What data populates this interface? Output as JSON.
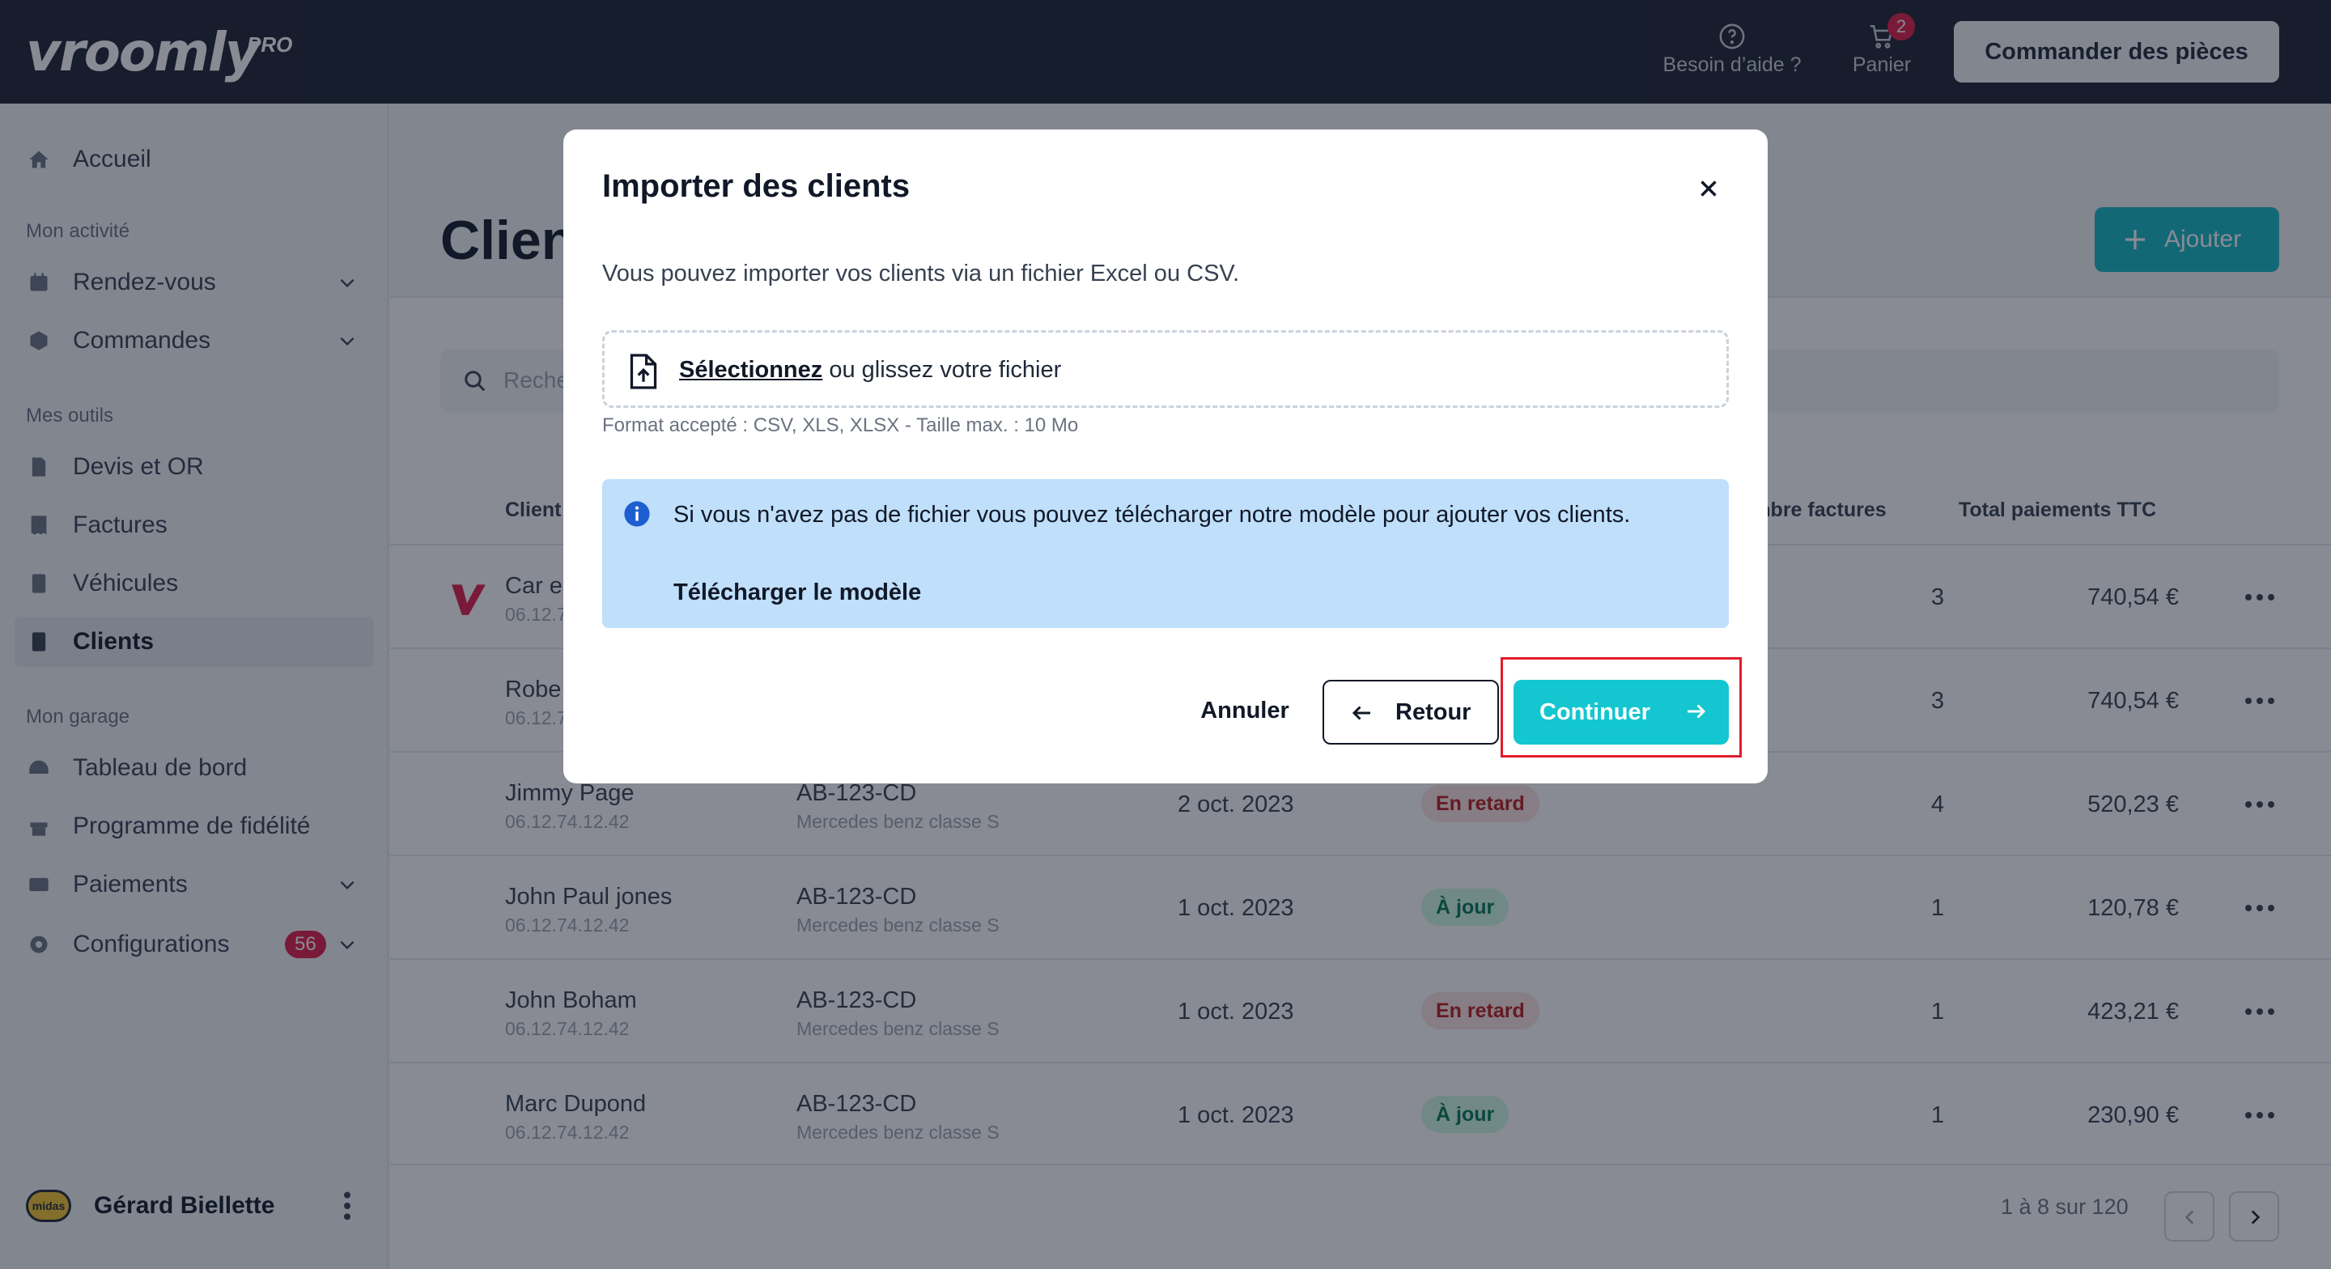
{
  "app": {
    "logo": "vroomly",
    "logo_badge": "PRO"
  },
  "topbar": {
    "help_label": "Besoin d’aide ?",
    "cart_label": "Panier",
    "cart_count": "2",
    "order_button": "Commander des pièces"
  },
  "sidebar": {
    "home": "Accueil",
    "section_activity": "Mon activité",
    "appointments": "Rendez-vous",
    "orders": "Commandes",
    "section_tools": "Mes outils",
    "quotes": "Devis et OR",
    "invoices": "Factures",
    "vehicles": "Véhicules",
    "clients": "Clients",
    "section_garage": "Mon garage",
    "dashboard": "Tableau de bord",
    "loyalty": "Programme de fidélité",
    "payments": "Paiements",
    "settings": "Configurations",
    "settings_badge": "56",
    "user_name": "Gérard Biellette",
    "avatar_text": "midas"
  },
  "page": {
    "title": "Clients",
    "add_button": "Ajouter",
    "search_placeholder": "Rechercher",
    "columns": {
      "client": "Client",
      "invoice_count": "Nombre factures",
      "total": "Total paiements TTC"
    },
    "rows": [
      {
        "name": "Car e",
        "phone": "06.12.74.12.42",
        "count": "3",
        "total": "740,54 €"
      },
      {
        "name": "Robe",
        "phone": "06.12.74.12.42",
        "count": "3",
        "total": "740,54 €"
      },
      {
        "name": "Jimmy Page",
        "phone": "06.12.74.12.42",
        "plate": "AB-123-CD",
        "model": "Mercedes benz classe S",
        "date": "2 oct. 2023",
        "status": "En retard",
        "count": "4",
        "total": "520,23 €"
      },
      {
        "name": "John Paul jones",
        "phone": "06.12.74.12.42",
        "plate": "AB-123-CD",
        "model": "Mercedes benz classe S",
        "date": "1 oct. 2023",
        "status": "À jour",
        "count": "1",
        "total": "120,78 €"
      },
      {
        "name": "John Boham",
        "phone": "06.12.74.12.42",
        "plate": "AB-123-CD",
        "model": "Mercedes benz classe S",
        "date": "1 oct. 2023",
        "status": "En retard",
        "count": "1",
        "total": "423,21 €"
      },
      {
        "name": "Marc Dupond",
        "phone": "06.12.74.12.42",
        "plate": "AB-123-CD",
        "model": "Mercedes benz classe S",
        "date": "1 oct. 2023",
        "status": "À jour",
        "count": "1",
        "total": "230,90 €"
      }
    ],
    "pagination": "1 à 8 sur 120"
  },
  "modal": {
    "title": "Importer des clients",
    "description": "Vous pouvez importer vos clients via un fichier Excel ou CSV.",
    "dropzone_link": "Sélectionnez",
    "dropzone_text": " ou glissez votre fichier",
    "format_hint": "Format accepté : CSV, XLS, XLSX - Taille max. : 10 Mo",
    "info_text": "Si vous n'avez pas de fichier vous pouvez télécharger notre modèle pour ajouter vos clients.",
    "info_link": "Télécharger le modèle",
    "cancel": "Annuler",
    "back": "Retour",
    "continue": "Continuer"
  },
  "colors": {
    "topbar": "#1c2333",
    "accent": "#13c6cf",
    "badge": "#e11d48",
    "info_bg": "#bfdffb",
    "highlight": "#e11d2a"
  }
}
